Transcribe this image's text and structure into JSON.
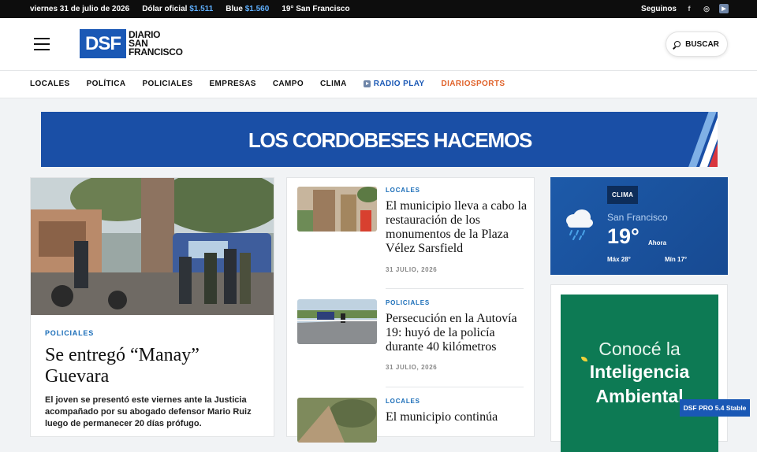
{
  "topbar": {
    "date": "viernes 31 de julio de 2026",
    "dolar_label": "Dólar oficial",
    "dolar_value": "$1.511",
    "blue_label": "Blue",
    "blue_value": "$1.560",
    "weather": "19° San Francisco",
    "follow": "Seguinos",
    "social": [
      "facebook-icon",
      "instagram-icon",
      "youtube-icon"
    ]
  },
  "header": {
    "logo_abbr": "DSF",
    "logo_line1": "DIARIO",
    "logo_line2": "SAN",
    "logo_line3": "FRANCISCO",
    "search_label": "BUSCAR"
  },
  "nav": {
    "items": [
      "LOCALES",
      "POLÍTICA",
      "POLICIALES",
      "EMPRESAS",
      "CAMPO",
      "CLIMA"
    ],
    "radio": "RADIO PLAY",
    "sports": "DIARIOSPORTS"
  },
  "banner": {
    "text": "LOS CORDOBESES HACEMOS"
  },
  "lead": {
    "category": "POLICIALES",
    "title": "Se entregó “Manay” Guevara",
    "description": "El joven se presentó este viernes ante la Justicia acompañado por su abogado defensor Mario Ruiz luego de permanecer 20 días prófugo."
  },
  "list": [
    {
      "category": "LOCALES",
      "title": "El municipio lleva a cabo la restauración de los monumentos de la Plaza Vélez Sarsfield",
      "date": "31 JULIO, 2026"
    },
    {
      "category": "POLICIALES",
      "title": "Persecución en la Autovía 19: huyó de la policía durante 40 kilómetros",
      "date": "31 JULIO, 2026"
    },
    {
      "category": "LOCALES",
      "title": "El municipio continúa"
    }
  ],
  "weather": {
    "tag": "CLIMA",
    "city": "San Francisco",
    "temp": "19°",
    "now": "Ahora",
    "max": "Máx 28°",
    "min": "Mín 17°",
    "icon": "rain-cloud-icon"
  },
  "ad": {
    "line1": "Conocé la",
    "line2": "Inteligencia",
    "line3": "Ambiental"
  },
  "version": "DSF PRO 5.4 Stable",
  "colors": {
    "brand": "#1a58b5",
    "category": "#1a6db8",
    "sports": "#e0622a",
    "weather_bg": "#1d5aa9",
    "ad_bg": "#0d7a54"
  }
}
